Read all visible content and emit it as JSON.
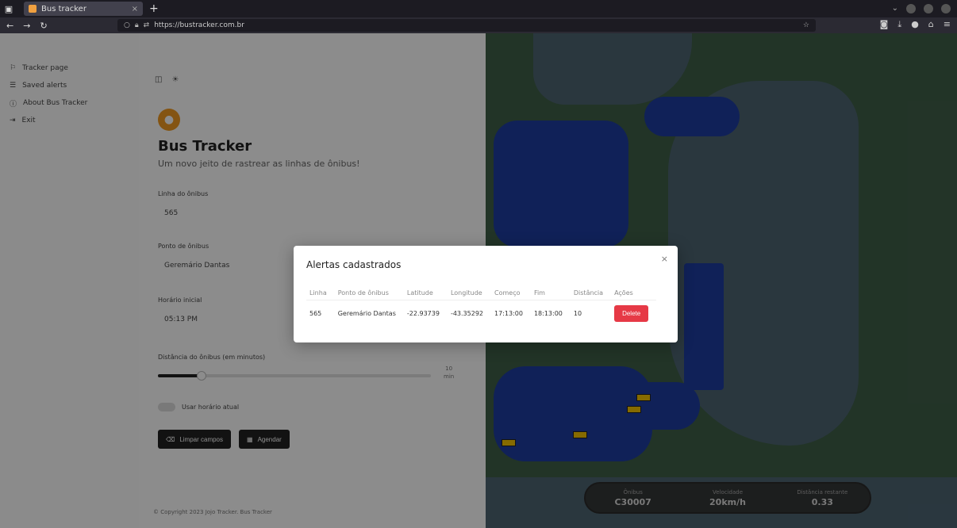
{
  "browser": {
    "tab_title": "Bus tracker",
    "tab_close": "×",
    "new_tab": "+",
    "url": "https://bustracker.com.br"
  },
  "sidebar": {
    "items": [
      {
        "icon": "map-icon",
        "label": "Tracker page"
      },
      {
        "icon": "list-icon",
        "label": "Saved alerts"
      },
      {
        "icon": "info-icon",
        "label": "About Bus Tracker"
      },
      {
        "icon": "logout-icon",
        "label": "Exit"
      }
    ]
  },
  "main": {
    "title": "Bus Tracker",
    "subtitle": "Um novo jeito de rastrear as linhas de ônibus!",
    "fields": {
      "line_label": "Linha do ônibus",
      "line_value": "565",
      "stop_label": "Ponto de ônibus",
      "stop_value": "Geremário Dantas",
      "time_label": "Horário inicial",
      "time_value": "05:13 PM",
      "distance_label": "Distância do ônibus (em minutos)",
      "distance_value": "10",
      "distance_unit": "min",
      "distance_fraction": 0.16,
      "toggle_label": "Usar horário atual"
    },
    "buttons": {
      "clear": "Limpar campos",
      "schedule": "Agendar"
    },
    "footer": "© Copyright 2023 Jojo Tracker. Bus Tracker"
  },
  "map_stats": [
    {
      "label": "Ônibus",
      "value": "C30007"
    },
    {
      "label": "Velocidade",
      "value": "20km/h"
    },
    {
      "label": "Distância restante",
      "value": "0.33"
    }
  ],
  "modal": {
    "title": "Alertas cadastrados",
    "close": "×",
    "columns": [
      "Linha",
      "Ponto de ônibus",
      "Latitude",
      "Longitude",
      "Começo",
      "Fim",
      "Distância",
      "Ações"
    ],
    "rows": [
      {
        "linha": "565",
        "ponto": "Geremário Dantas",
        "latitude": "-22.93739",
        "longitude": "-43.35292",
        "comeco": "17:13:00",
        "fim": "18:13:00",
        "distancia": "10",
        "action": "Delete"
      }
    ]
  },
  "colors": {
    "accent": "#f09a22",
    "delete": "#e63946",
    "route": "#1e3da0"
  }
}
